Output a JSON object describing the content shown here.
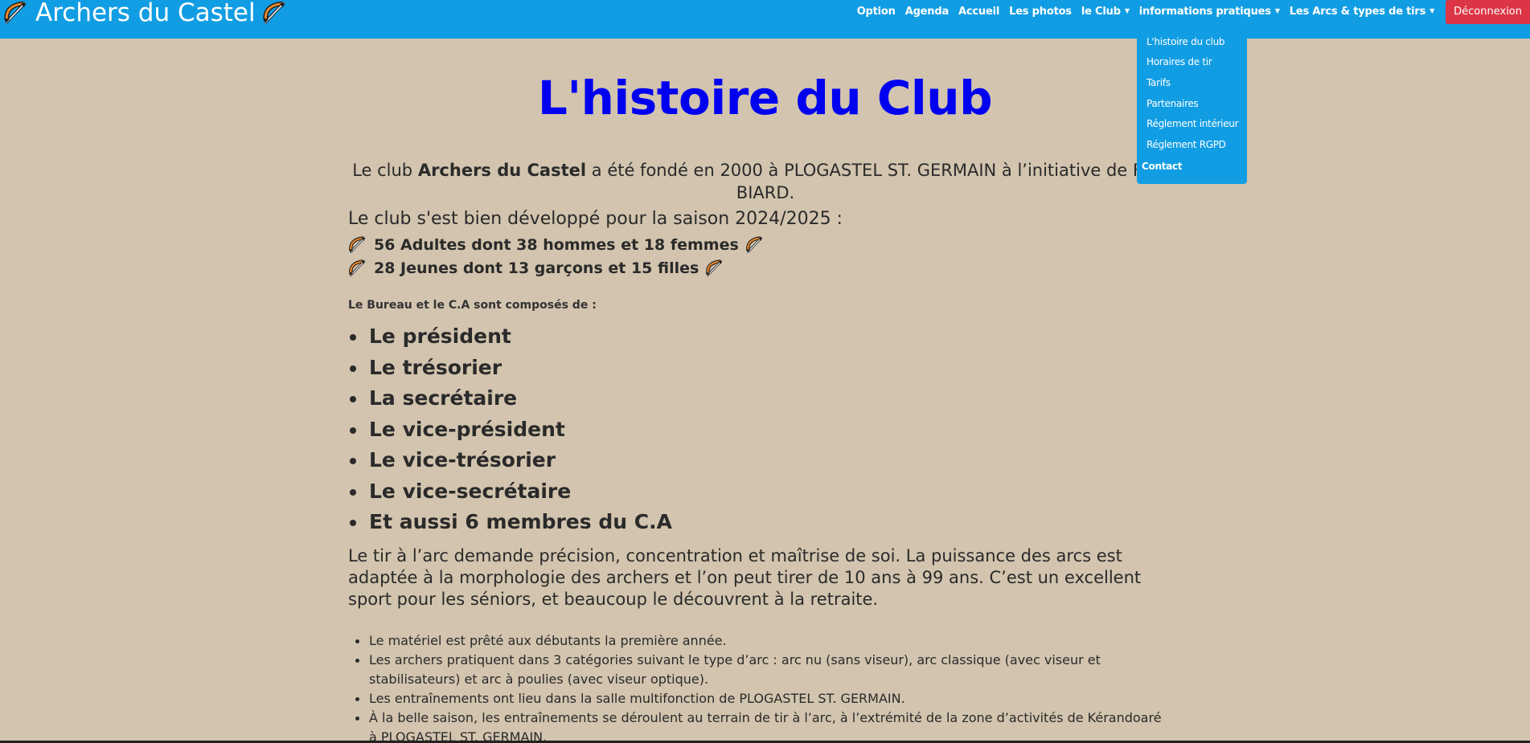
{
  "brand": {
    "title": "Archers du Castel",
    "icon": "bow-and-arrow-icon"
  },
  "nav": {
    "items": [
      {
        "label": "Option"
      },
      {
        "label": "Agenda"
      },
      {
        "label": "Accueil"
      },
      {
        "label": "Les photos"
      },
      {
        "label": "le Club",
        "dropdown": true
      },
      {
        "label": "informations pratiques",
        "dropdown": true
      },
      {
        "label": "Les Arcs & types de tirs",
        "dropdown": true
      }
    ],
    "logout_label": "Déconnexion"
  },
  "dropdown": {
    "items": [
      {
        "label": "L'histoire du club"
      },
      {
        "label": "Horaires de tir"
      },
      {
        "label": "Tarifs"
      },
      {
        "label": "Partenaires"
      },
      {
        "label": "Réglement intérieur"
      },
      {
        "label": "Réglement RGPD"
      },
      {
        "label": "Contact"
      }
    ]
  },
  "content": {
    "title": "L'histoire du Club",
    "intro_prefix": "Le club ",
    "intro_club": "Archers du Castel",
    "intro_suffix": " a été fondé en 2000 à PLOGASTEL ST. GERMAIN à l’initiative de Franc",
    "intro_line2": "BIARD.",
    "season": "Le club s'est bien développé pour la saison 2024/2025 :",
    "adults": "56 Adultes dont 38 hommes et 18 femmes",
    "youth": "28 Jeunes dont 13 garçons et 15 filles",
    "bureau_label": "Le Bureau et le C.A sont composés de :",
    "roles": [
      "Le président",
      "Le trésorier",
      "La secrétaire",
      "Le vice-président",
      "Le vice-trésorier",
      "Le vice-secrétaire",
      "Et aussi 6 membres du C.A"
    ],
    "paragraph": "Le tir à l’arc demande précision, concentration et maîtrise de soi. La puissance des arcs est adaptée à la morphologie des archers et l’on peut tirer de 10 ans à 99 ans. C’est un excellent sport pour les séniors, et beaucoup le découvrent à la retraite.",
    "facts": [
      "Le matériel est prêté aux débutants la première année.",
      "Les archers pratiquent dans 3 catégories suivant le type d’arc : arc nu (sans viseur), arc classique (avec viseur et stabilisateurs) et arc à poulies (avec viseur optique).",
      "Les entraînements ont lieu dans la salle multifonction de PLOGASTEL ST. GERMAIN.",
      "À la belle saison, les entraînements se déroulent au terrain de tir à l’arc, à l’extrémité de la zone d’activités de Kérandoaré à PLOGASTEL ST. GERMAIN."
    ]
  }
}
